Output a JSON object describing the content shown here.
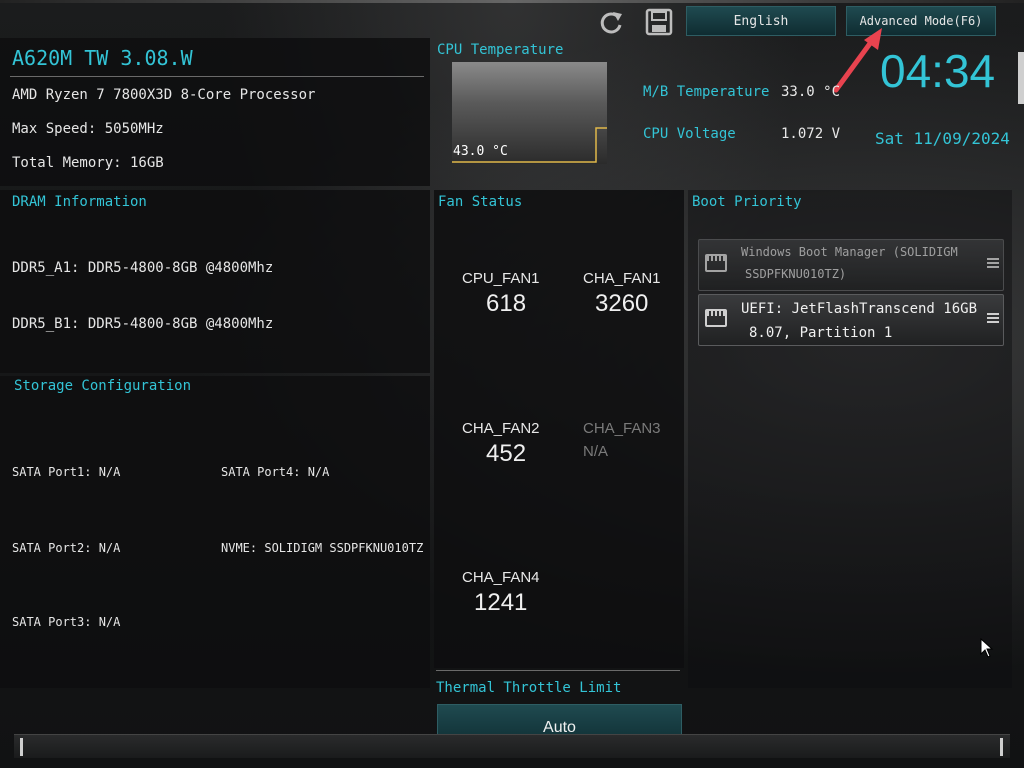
{
  "header": {
    "board_name": "A620M TW 3.08.W",
    "language_button": "English",
    "advanced_mode_button": "Advanced Mode(F6)",
    "clock": "04:34",
    "date": "Sat 11/09/2024"
  },
  "system": {
    "cpu_name": "AMD Ryzen 7 7800X3D 8-Core Processor",
    "max_speed": "Max Speed: 5050MHz",
    "total_memory": "Total Memory: 16GB"
  },
  "cpu_temp": {
    "title": "CPU Temperature",
    "value": "43.0 °C"
  },
  "readouts": {
    "mb_temp_label": "M/B Temperature",
    "mb_temp_value": "33.0 °C",
    "cpu_voltage_label": "CPU Voltage",
    "cpu_voltage_value": "1.072 V"
  },
  "dram": {
    "title": "DRAM Information",
    "slots": [
      "DDR5_A1: DDR5-4800-8GB @4800Mhz",
      "DDR5_B1: DDR5-4800-8GB @4800Mhz"
    ]
  },
  "storage": {
    "title": "Storage Configuration",
    "sata1": "SATA Port1: N/A",
    "sata2": "SATA Port2: N/A",
    "sata3": "SATA Port3: N/A",
    "sata4": "SATA Port4: N/A",
    "nvme": "NVME: SOLIDIGM SSDPFKNU010TZ"
  },
  "fans": {
    "title": "Fan Status",
    "cpu_fan1": {
      "name": "CPU_FAN1",
      "value": "618"
    },
    "cha_fan1": {
      "name": "CHA_FAN1",
      "value": "3260"
    },
    "cha_fan2": {
      "name": "CHA_FAN2",
      "value": "452"
    },
    "cha_fan3": {
      "name": "CHA_FAN3",
      "value": "N/A"
    },
    "cha_fan4": {
      "name": "CHA_FAN4",
      "value": "1241"
    }
  },
  "throttle": {
    "title": "Thermal Throttle Limit",
    "value": "Auto"
  },
  "boot": {
    "title": "Boot Priority",
    "item1_line1": "Windows Boot Manager (SOLIDIGM",
    "item1_line2": "SSDPFKNU010TZ)",
    "item2_line1": "UEFI: JetFlashTranscend 16GB",
    "item2_line2": "8.07, Partition 1"
  },
  "colors": {
    "accent": "#33c4d6",
    "arrow": "#e8434f",
    "graph_line": "#e0b84a"
  },
  "icons": [
    "refresh-icon",
    "save-icon",
    "drive-icon",
    "drag-handle-icon",
    "mouse-cursor-icon"
  ]
}
